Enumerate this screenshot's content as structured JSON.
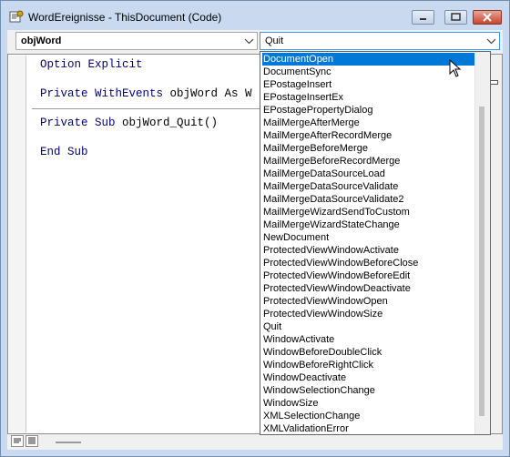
{
  "window": {
    "title": "WordEreignisse - ThisDocument (Code)"
  },
  "object_combo": {
    "value": "objWord"
  },
  "procedure_combo": {
    "value": "Quit",
    "options": [
      "DocumentOpen",
      "DocumentSync",
      "EPostageInsert",
      "EPostageInsertEx",
      "EPostagePropertyDialog",
      "MailMergeAfterMerge",
      "MailMergeAfterRecordMerge",
      "MailMergeBeforeMerge",
      "MailMergeBeforeRecordMerge",
      "MailMergeDataSourceLoad",
      "MailMergeDataSourceValidate",
      "MailMergeDataSourceValidate2",
      "MailMergeWizardSendToCustom",
      "MailMergeWizardStateChange",
      "NewDocument",
      "ProtectedViewWindowActivate",
      "ProtectedViewWindowBeforeClose",
      "ProtectedViewWindowBeforeEdit",
      "ProtectedViewWindowDeactivate",
      "ProtectedViewWindowOpen",
      "ProtectedViewWindowSize",
      "Quit",
      "WindowActivate",
      "WindowBeforeDoubleClick",
      "WindowBeforeRightClick",
      "WindowDeactivate",
      "WindowSelectionChange",
      "WindowSize",
      "XMLSelectionChange",
      "XMLValidationError"
    ],
    "highlighted": "DocumentOpen"
  },
  "code": {
    "line1_kw": "Option Explicit",
    "line2_kw": "Private WithEvents",
    "line2_rest": " objWord As W",
    "line3_kw": "Private Sub",
    "line3_rest": " objWord_Quit()",
    "line4_kw": "End Sub"
  },
  "colors": {
    "keyword": "#00007f",
    "selection": "#0078d7"
  }
}
